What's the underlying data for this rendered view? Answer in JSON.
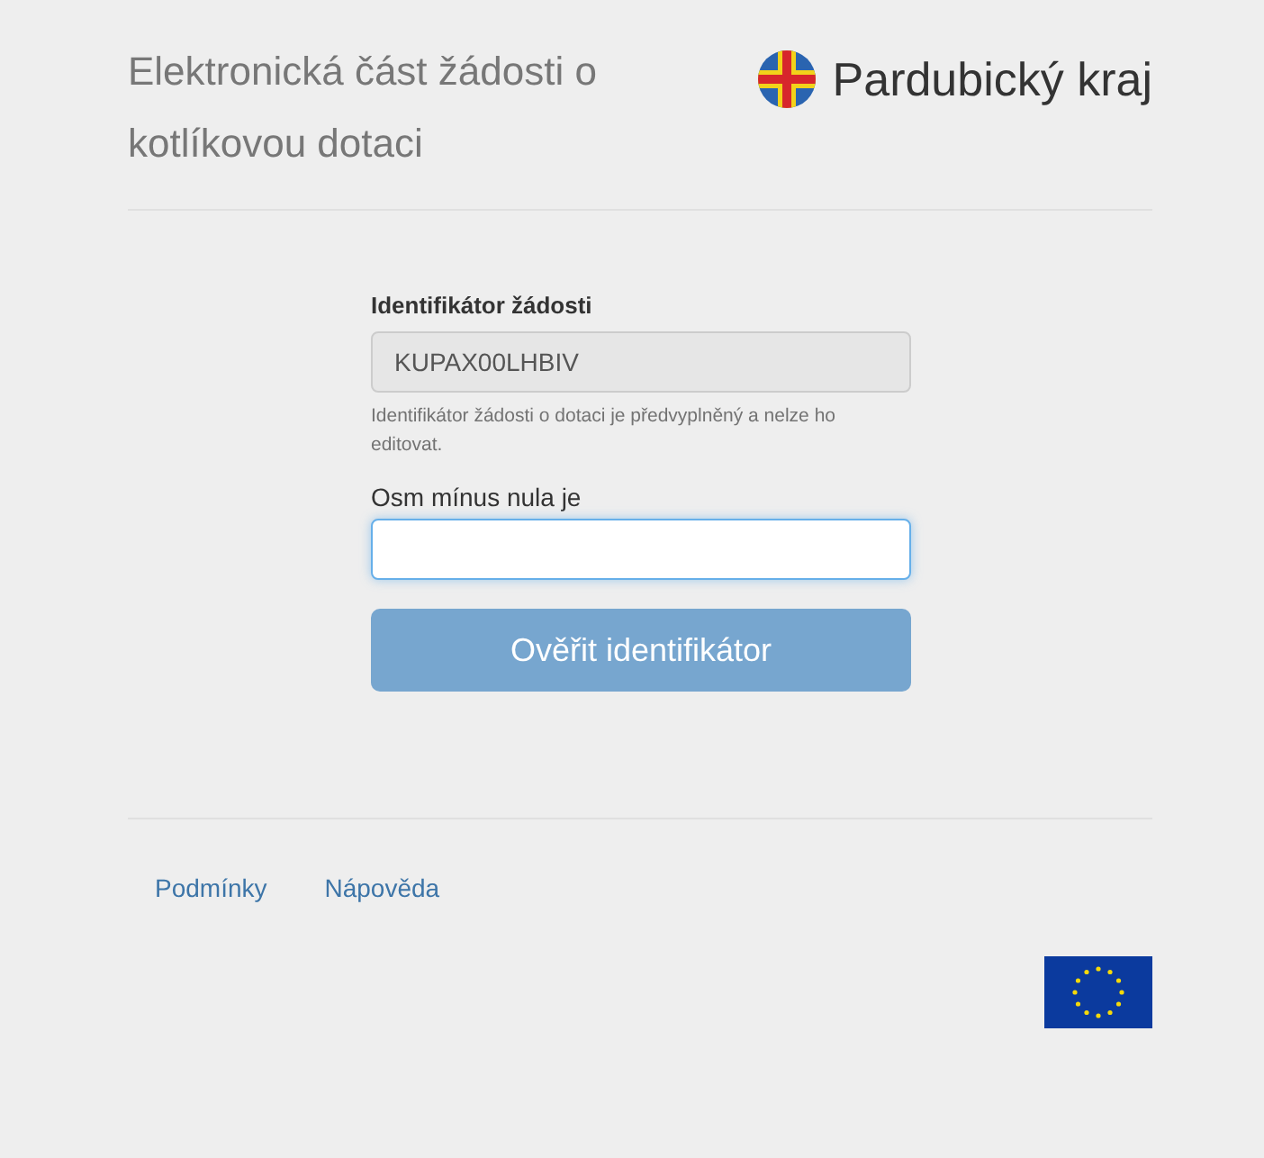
{
  "header": {
    "title": "Elektronická část žádosti o kotlíkovou dotaci",
    "brand": "Pardubický kraj"
  },
  "form": {
    "id_field": {
      "label": "Identifikátor žádosti",
      "value": "KUPAX00LHBIV",
      "disabled": true,
      "help": "Identifikátor žádosti o dotaci je předvyplněný a nelze ho editovat."
    },
    "captcha_field": {
      "label": "Osm mínus nula je",
      "focused": true
    },
    "submit": {
      "label": "Ověřit identifikátor",
      "disabled": true
    }
  },
  "footer": {
    "links": [
      "Podmínky",
      "Nápověda"
    ]
  }
}
